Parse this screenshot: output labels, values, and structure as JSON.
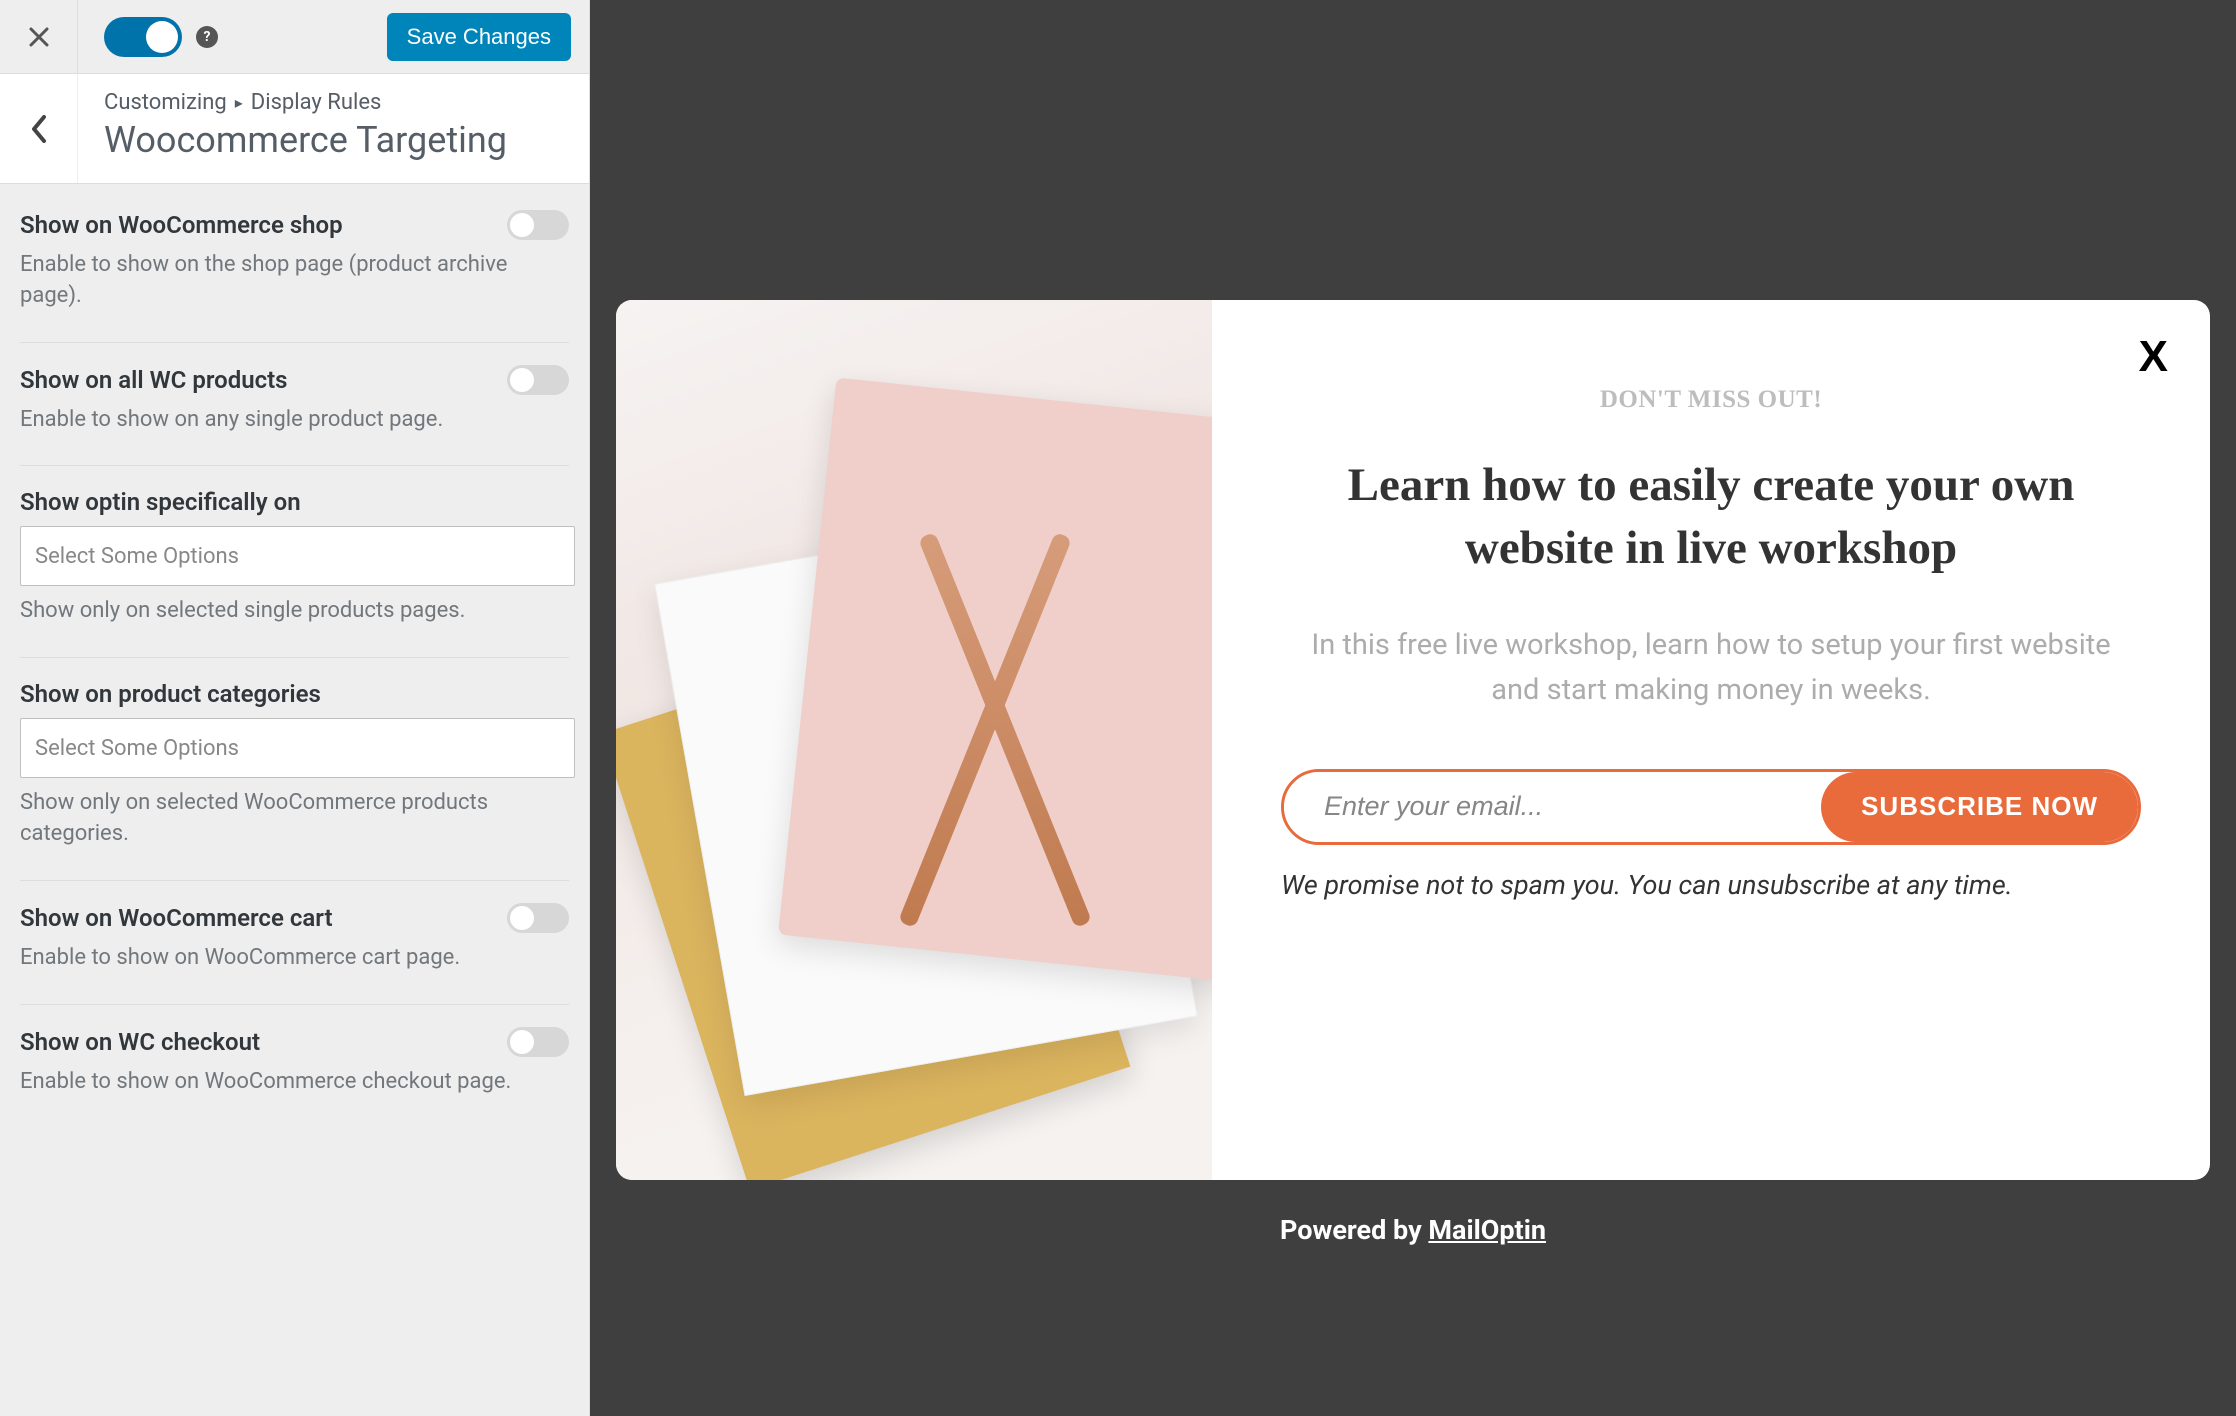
{
  "topbar": {
    "save_label": "Save Changes"
  },
  "header": {
    "breadcrumb_root": "Customizing",
    "breadcrumb_current": "Display Rules",
    "title": "Woocommerce Targeting"
  },
  "settings": [
    {
      "id": "shop",
      "label": "Show on WooCommerce shop",
      "desc": "Enable to show on the shop page (product archive page).",
      "has_toggle": true
    },
    {
      "id": "products",
      "label": "Show on all WC products",
      "desc": "Enable to show on any single product page.",
      "has_toggle": true
    },
    {
      "id": "specific",
      "label": "Show optin specifically on",
      "placeholder": "Select Some Options",
      "desc": "Show only on selected single products pages.",
      "has_select": true
    },
    {
      "id": "categories",
      "label": "Show on product categories",
      "placeholder": "Select Some Options",
      "desc": "Show only on selected WooCommerce products categories.",
      "has_select": true
    },
    {
      "id": "cart",
      "label": "Show on WooCommerce cart",
      "desc": "Enable to show on WooCommerce cart page.",
      "has_toggle": true
    },
    {
      "id": "checkout",
      "label": "Show on WC checkout",
      "desc": "Enable to show on WooCommerce checkout page.",
      "has_toggle": true
    }
  ],
  "popup": {
    "overline": "DON'T MISS OUT!",
    "headline": "Learn how to easily create your own website in live workshop",
    "subtext": "In this free live workshop, learn how to setup your first website and start making money in weeks.",
    "email_placeholder": "Enter your email...",
    "button_label": "SUBSCRIBE NOW",
    "disclaimer": "We promise not to spam you. You can unsubscribe at any time."
  },
  "powered": {
    "prefix": "Powered by ",
    "brand": "MailOptin"
  },
  "colors": {
    "accent_blue": "#0085ba",
    "accent_orange": "#e96a3a"
  }
}
